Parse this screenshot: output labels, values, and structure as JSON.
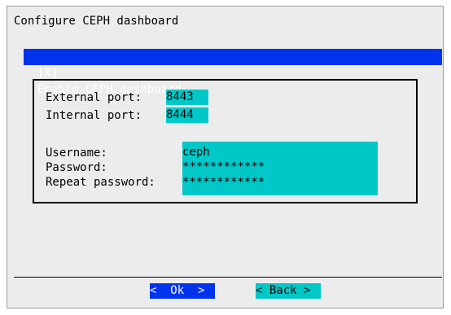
{
  "dialog": {
    "title": "Configure CEPH dashboard",
    "enable_checkbox": {
      "mark": "[X]",
      "label": "Enable CEPH dashboard",
      "checked": true
    },
    "ports": {
      "external_label": "External port:",
      "external_value": "8443",
      "internal_label": "Internal port:",
      "internal_value": "8444"
    },
    "credentials": {
      "username_label": "Username:",
      "username_value": "ceph",
      "password_label": "Password:",
      "password_value": "************",
      "repeat_label": "Repeat password:",
      "repeat_value": "************"
    },
    "buttons": {
      "ok_label": "<  Ok  >",
      "back_label": "< Back >"
    }
  },
  "colors": {
    "selection": "#0033ee",
    "field": "#00c8c8",
    "panel": "#ececec"
  }
}
